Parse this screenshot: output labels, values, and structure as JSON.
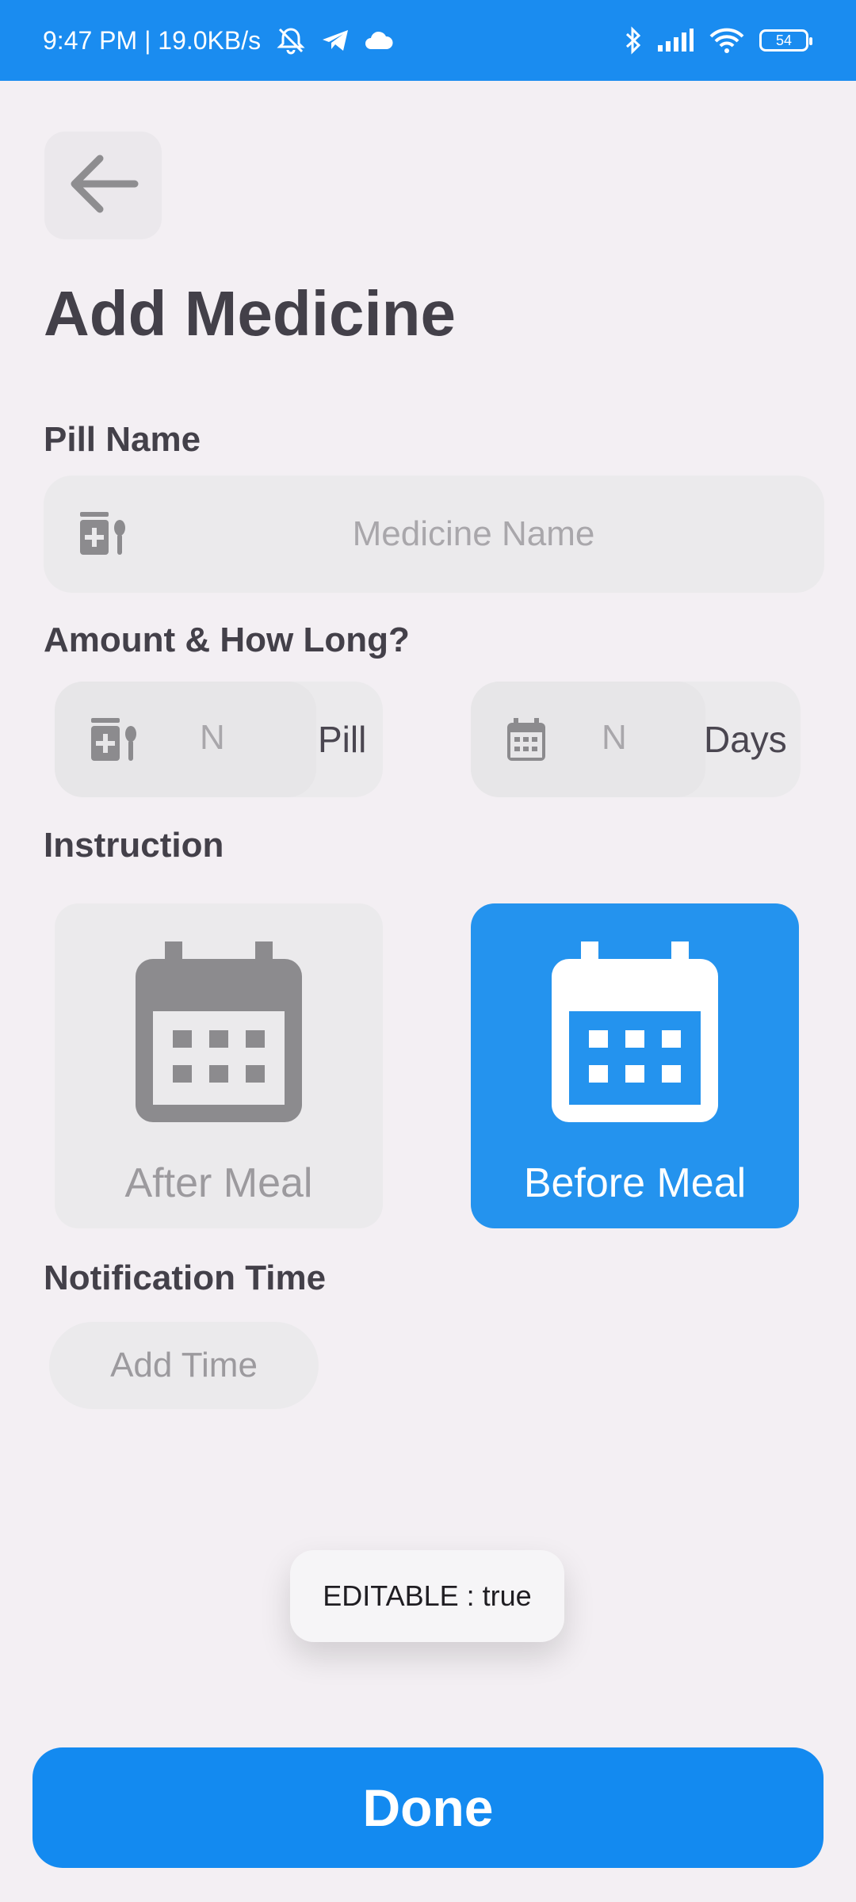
{
  "status_bar": {
    "time_network": "9:47 PM | 19.0KB/s",
    "battery_level": "54",
    "icons": [
      "mute-bell-icon",
      "telegram-icon",
      "cloud-icon",
      "bluetooth-icon",
      "signal-icon",
      "wifi-icon",
      "battery-icon"
    ]
  },
  "header": {
    "back_icon": "arrow-left-icon",
    "title": "Add Medicine"
  },
  "pill_name": {
    "label": "Pill Name",
    "placeholder": "Medicine Name",
    "icon": "medicine-icon"
  },
  "amount": {
    "label": "Amount & How Long?",
    "amount_value": "N",
    "amount_unit": "Pill",
    "days_value": "N",
    "days_unit": "Days"
  },
  "instruction": {
    "label": "Instruction",
    "options": [
      {
        "label": "After Meal",
        "selected": false
      },
      {
        "label": "Before Meal",
        "selected": true
      }
    ]
  },
  "notification": {
    "label": "Notification Time",
    "add_time_label": "Add Time"
  },
  "toast": {
    "text": "EDITABLE : true"
  },
  "footer": {
    "done_label": "Done"
  },
  "colors": {
    "status_bar": "#1a8cf0",
    "accent": "#2493ee",
    "done_button": "#138af0",
    "background": "#f3eff3"
  }
}
